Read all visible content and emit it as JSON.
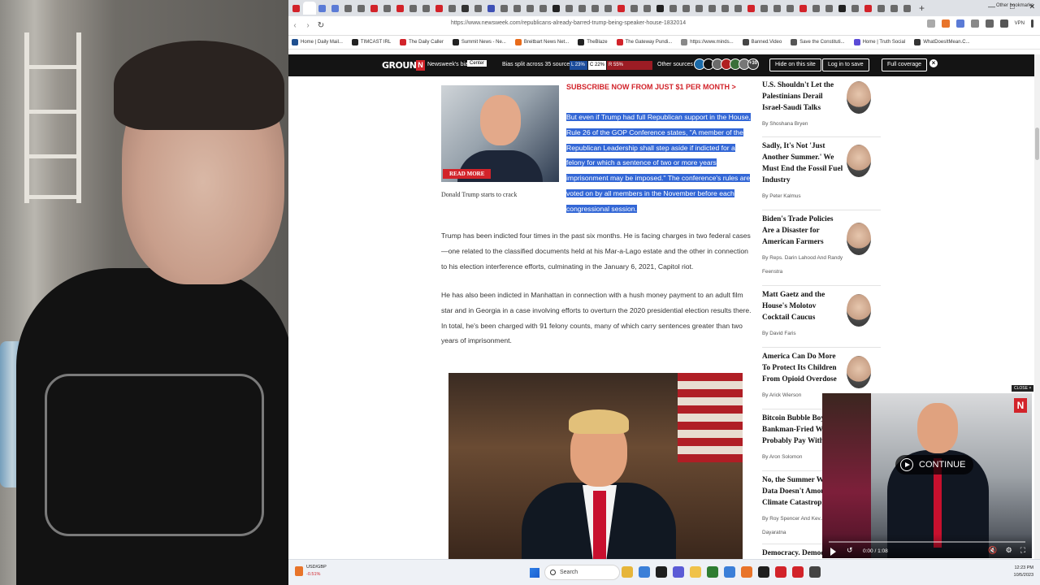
{
  "browser": {
    "url": "https://www.newsweek.com/republicans-already-barred-trump-being-speaker-house-1832014",
    "tab_colors": [
      "#d2232a",
      "#ffffff",
      "#5b7bd6",
      "#5b7bd6",
      "#6a6a6a",
      "#6a6a6a",
      "#d2232a",
      "#6a6a6a",
      "#d2232a",
      "#6a6a6a",
      "#6a6a6a",
      "#d2232a",
      "#6a6a6a",
      "#333333",
      "#6a6a6a",
      "#3f51b5",
      "#6a6a6a",
      "#6a6a6a",
      "#6a6a6a",
      "#6a6a6a",
      "#222222",
      "#6a6a6a",
      "#6a6a6a",
      "#6a6a6a",
      "#6a6a6a",
      "#d2232a",
      "#6a6a6a",
      "#6a6a6a",
      "#222222",
      "#6a6a6a",
      "#6a6a6a",
      "#6a6a6a",
      "#6a6a6a",
      "#6a6a6a",
      "#6a6a6a",
      "#d2232a",
      "#6a6a6a",
      "#6a6a6a",
      "#6a6a6a",
      "#d2232a",
      "#6a6a6a",
      "#6a6a6a",
      "#222222",
      "#6a6a6a",
      "#d2232a",
      "#6a6a6a",
      "#6a6a6a",
      "#6a6a6a"
    ],
    "vpn_label": "VPN",
    "bookmarks": [
      {
        "label": "Home | Daily Mail...",
        "color": "#1f4f8f"
      },
      {
        "label": "TIMCAST IRL",
        "color": "#222222"
      },
      {
        "label": "The Daily Caller",
        "color": "#d2232a"
      },
      {
        "label": "Summit News - Ne...",
        "color": "#222222"
      },
      {
        "label": "Breitbart News Net...",
        "color": "#e86b1a"
      },
      {
        "label": "TheBlaze",
        "color": "#222222"
      },
      {
        "label": "The Gateway Pundi...",
        "color": "#d2232a"
      },
      {
        "label": "https://www.minds...",
        "color": "#888888"
      },
      {
        "label": "Banned.Video",
        "color": "#444444"
      },
      {
        "label": "Save the Constituti...",
        "color": "#555555"
      },
      {
        "label": "Home | Truth Social",
        "color": "#5b4bd6"
      },
      {
        "label": "WhatDoesItMean.C...",
        "color": "#333333"
      }
    ],
    "other_bookmarks": "Other bookmarks"
  },
  "ground_news": {
    "logo": "GROUND",
    "bias_label": "Newsweek's bias:",
    "bias_value": "Center",
    "split_label": "Bias split across 35 sources",
    "segments": [
      {
        "label": "L 23%",
        "color": "#1c4c9c"
      },
      {
        "label": "C 22%",
        "color": "#ffffff"
      },
      {
        "label": "R 55%",
        "color": "#9c1c24"
      }
    ],
    "other_sources": "Other sources",
    "source_count": "+30",
    "source_colors": [
      "#1a6aa8",
      "#111111",
      "#6b6b6b",
      "#b02020",
      "#3a6f3a",
      "#777777"
    ],
    "hide_btn": "Hide on this site",
    "login_btn": "Log in to save",
    "coverage_btn": "Full coverage",
    "close": "×"
  },
  "article": {
    "subscribe": "SUBSCRIBE NOW FROM JUST $1 PER MONTH >",
    "read_more": "READ MORE",
    "caption": "Donald Trump starts to crack",
    "highlight": "But even if Trump had full Republican support in the House, Rule 26 of the GOP Conference states, \"A member of the Republican Leadership shall step aside if indicted for a felony for which a sentence of two or more years imprisonment may be imposed.\" The conference's rules are voted on by all members in the November before each congressional session.",
    "para1": "Trump has been indicted four times in the past six months. He is facing charges in two federal cases—one related to the classified documents held at his Mar-a-Lago estate and the other in connection to his election interference efforts, culminating in the January 6, 2021, Capitol riot.",
    "para2": "He has also been indicted in Manhattan in connection with a hush money payment to an adult film star and in Georgia in a case involving efforts to overturn the 2020 presidential election results there. In total, he's been charged with 91 felony counts, many of which carry sentences greater than two years of imprisonment."
  },
  "sidebar": [
    {
      "title": "U.S. Shouldn't Let the Palestinians Derail Israel-Saudi Talks",
      "author": "By Shoshana Bryen"
    },
    {
      "title": "Sadly, It's Not 'Just Another Summer.' We Must End the Fossil Fuel Industry",
      "author": "By Peter Kalmus"
    },
    {
      "title": "Biden's Trade Policies Are a Disaster for American Farmers",
      "author": "By Reps. Darin Lahood And Randy Feenstra"
    },
    {
      "title": "Matt Gaetz and the House's Molotov Cocktail Caucus",
      "author": "By David Faris"
    },
    {
      "title": "America Can Do More To Protect Its Children From Opioid Overdose",
      "author": "By Arick Wierson"
    },
    {
      "title": "Bitcoin Bubble Boy Bankman-Fried Wi... Probably Pay With H...",
      "author": "By Aron Solomon"
    },
    {
      "title": "No, the Summer We... Data Doesn't Amou... Climate Catastroph...",
      "author": "By Roy Spencer And Kev... Dayaratna"
    },
    {
      "title": "Democracy. Democrats...",
      "author": ""
    }
  ],
  "video": {
    "close": "CLOSE ×",
    "logo": "N",
    "continue": "CONTINUE",
    "time": "0:00 / 1:08",
    "progress": 0
  },
  "taskbar": {
    "ticker": "USD/GBP",
    "change": "-0.51%",
    "search": "Search",
    "time": "12:23 PM",
    "date": "10/5/2023",
    "app_colors": [
      "#e6b53a",
      "#3b7fd8",
      "#1e1e1e",
      "#5b5bd6",
      "#f0c24a",
      "#2e7d32",
      "#3b7fd8",
      "#e8742a",
      "#1e1e1e",
      "#d2232a",
      "#d2232a",
      "#444444"
    ]
  }
}
